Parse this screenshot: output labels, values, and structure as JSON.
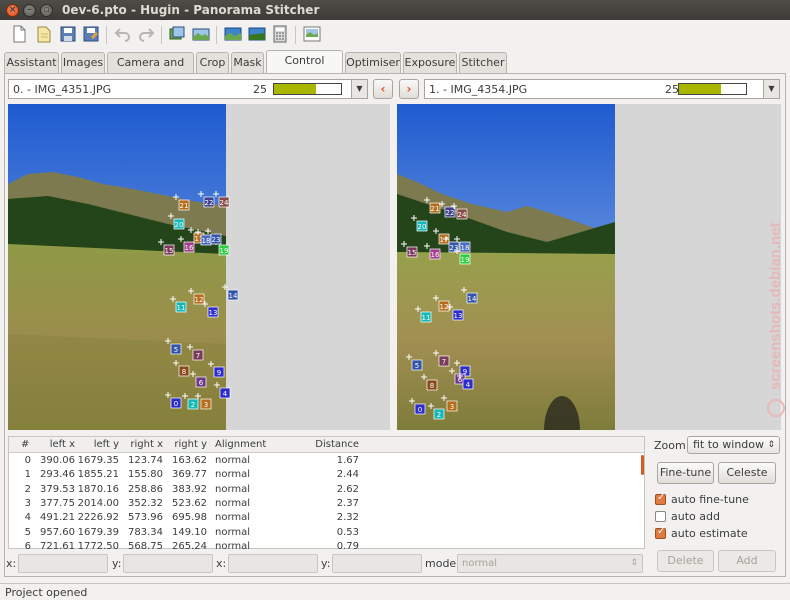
{
  "window": {
    "title": "0ev-6.pto - Hugin - Panorama Stitcher"
  },
  "toolbar": {
    "icons": [
      "new-file-icon",
      "open-file-icon",
      "save-icon",
      "save-as-icon",
      "undo-icon",
      "redo-icon",
      "add-images-icon",
      "align-images-icon",
      "preview-icon",
      "fast-preview-icon",
      "calculator-icon",
      "stitch-icon"
    ]
  },
  "tabs": [
    {
      "label": "Assistant"
    },
    {
      "label": "Images"
    },
    {
      "label": "Camera and Lens"
    },
    {
      "label": "Crop"
    },
    {
      "label": "Mask"
    },
    {
      "label": "Control Points"
    },
    {
      "label": "Optimiser"
    },
    {
      "label": "Exposure"
    },
    {
      "label": "Stitcher"
    }
  ],
  "active_tab": "Control Points",
  "left_image": {
    "label": "0. - IMG_4351.JPG",
    "count": "25",
    "progress": 0.62
  },
  "right_image": {
    "label": "1. - IMG_4354.JPG",
    "count": "25",
    "progress": 0.62
  },
  "nav": {
    "prev": "‹",
    "next": "›"
  },
  "table": {
    "headers": [
      "#",
      "left x",
      "left y",
      "right x",
      "right y",
      "Alignment",
      "Distance"
    ],
    "rows": [
      [
        "0",
        "390.06",
        "1679.35",
        "123.74",
        "163.62",
        "normal",
        "1.67"
      ],
      [
        "1",
        "293.46",
        "1855.21",
        "155.80",
        "369.77",
        "normal",
        "2.44"
      ],
      [
        "2",
        "379.53",
        "1870.16",
        "258.86",
        "383.92",
        "normal",
        "2.62"
      ],
      [
        "3",
        "377.75",
        "2014.00",
        "352.32",
        "523.62",
        "normal",
        "2.37"
      ],
      [
        "4",
        "491.21",
        "2226.92",
        "573.96",
        "695.98",
        "normal",
        "2.32"
      ],
      [
        "5",
        "957.60",
        "1679.39",
        "783.34",
        "149.10",
        "normal",
        "0.53"
      ],
      [
        "6",
        "721.61",
        "1772.50",
        "568.75",
        "265.24",
        "normal",
        "0.79"
      ]
    ]
  },
  "controls": {
    "zoom_label": "Zoom:",
    "zoom_value": "fit to window",
    "finetune": "Fine-tune",
    "celeste": "Celeste",
    "auto_finetune": "auto fine-tune",
    "auto_add": "auto add",
    "auto_estimate": "auto estimate",
    "delete": "Delete",
    "add": "Add"
  },
  "bottom": {
    "x1_label": "x:",
    "y1_label": "y:",
    "x2_label": "x:",
    "y2_label": "y:",
    "mode_label": "mode:",
    "mode_value": "normal"
  },
  "status": "Project opened",
  "watermark": "screenshots.debian.net",
  "colors": {
    "accent": "#dd4814",
    "progress_fill": "#aab700"
  }
}
